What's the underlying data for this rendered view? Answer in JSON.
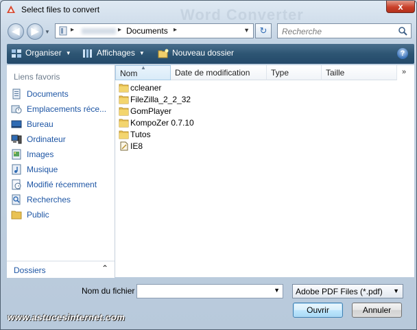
{
  "window": {
    "title": "Select files to convert",
    "background_title": "Word Converter",
    "close_label": "x"
  },
  "address_bar": {
    "breadcrumbs": [
      "Documents"
    ],
    "separator": "▸"
  },
  "search": {
    "placeholder": "Recherche"
  },
  "toolbar": {
    "organize_label": "Organiser",
    "views_label": "Affichages",
    "new_folder_label": "Nouveau dossier",
    "help_label": "?"
  },
  "sidebar": {
    "favorites_title": "Liens favoris",
    "items": [
      {
        "label": "Documents",
        "icon": "documents-icon"
      },
      {
        "label": "Emplacements réce...",
        "icon": "recent-places-icon"
      },
      {
        "label": "Bureau",
        "icon": "desktop-icon"
      },
      {
        "label": "Ordinateur",
        "icon": "computer-icon"
      },
      {
        "label": "Images",
        "icon": "pictures-icon"
      },
      {
        "label": "Musique",
        "icon": "music-icon"
      },
      {
        "label": "Modifié récemment",
        "icon": "recently-changed-icon"
      },
      {
        "label": "Recherches",
        "icon": "searches-icon"
      },
      {
        "label": "Public",
        "icon": "public-folder-icon"
      }
    ],
    "folders_label": "Dossiers"
  },
  "file_list": {
    "columns": [
      "Nom",
      "Date de modification",
      "Type",
      "Taille"
    ],
    "more_columns": "»",
    "files": [
      {
        "name": "ccleaner",
        "icon": "folder-icon"
      },
      {
        "name": "FileZilla_2_2_32",
        "icon": "folder-icon"
      },
      {
        "name": "GomPlayer",
        "icon": "folder-icon"
      },
      {
        "name": "KompoZer 0.7.10",
        "icon": "folder-icon"
      },
      {
        "name": "Tutos",
        "icon": "folder-icon"
      },
      {
        "name": "IE8",
        "icon": "file-icon"
      }
    ]
  },
  "footer": {
    "filename_label": "Nom du fichier :",
    "filename_value": "",
    "filetype_selected": "Adobe PDF Files (*.pdf)",
    "open_label": "Ouvrir",
    "cancel_label": "Annuler"
  },
  "watermark": {
    "text": "www.astucesinternet.com"
  },
  "colors": {
    "toolbar": "#2d5573",
    "link_text": "#1d55a4",
    "folder": "#e9c254",
    "close_button": "#c9412a"
  }
}
